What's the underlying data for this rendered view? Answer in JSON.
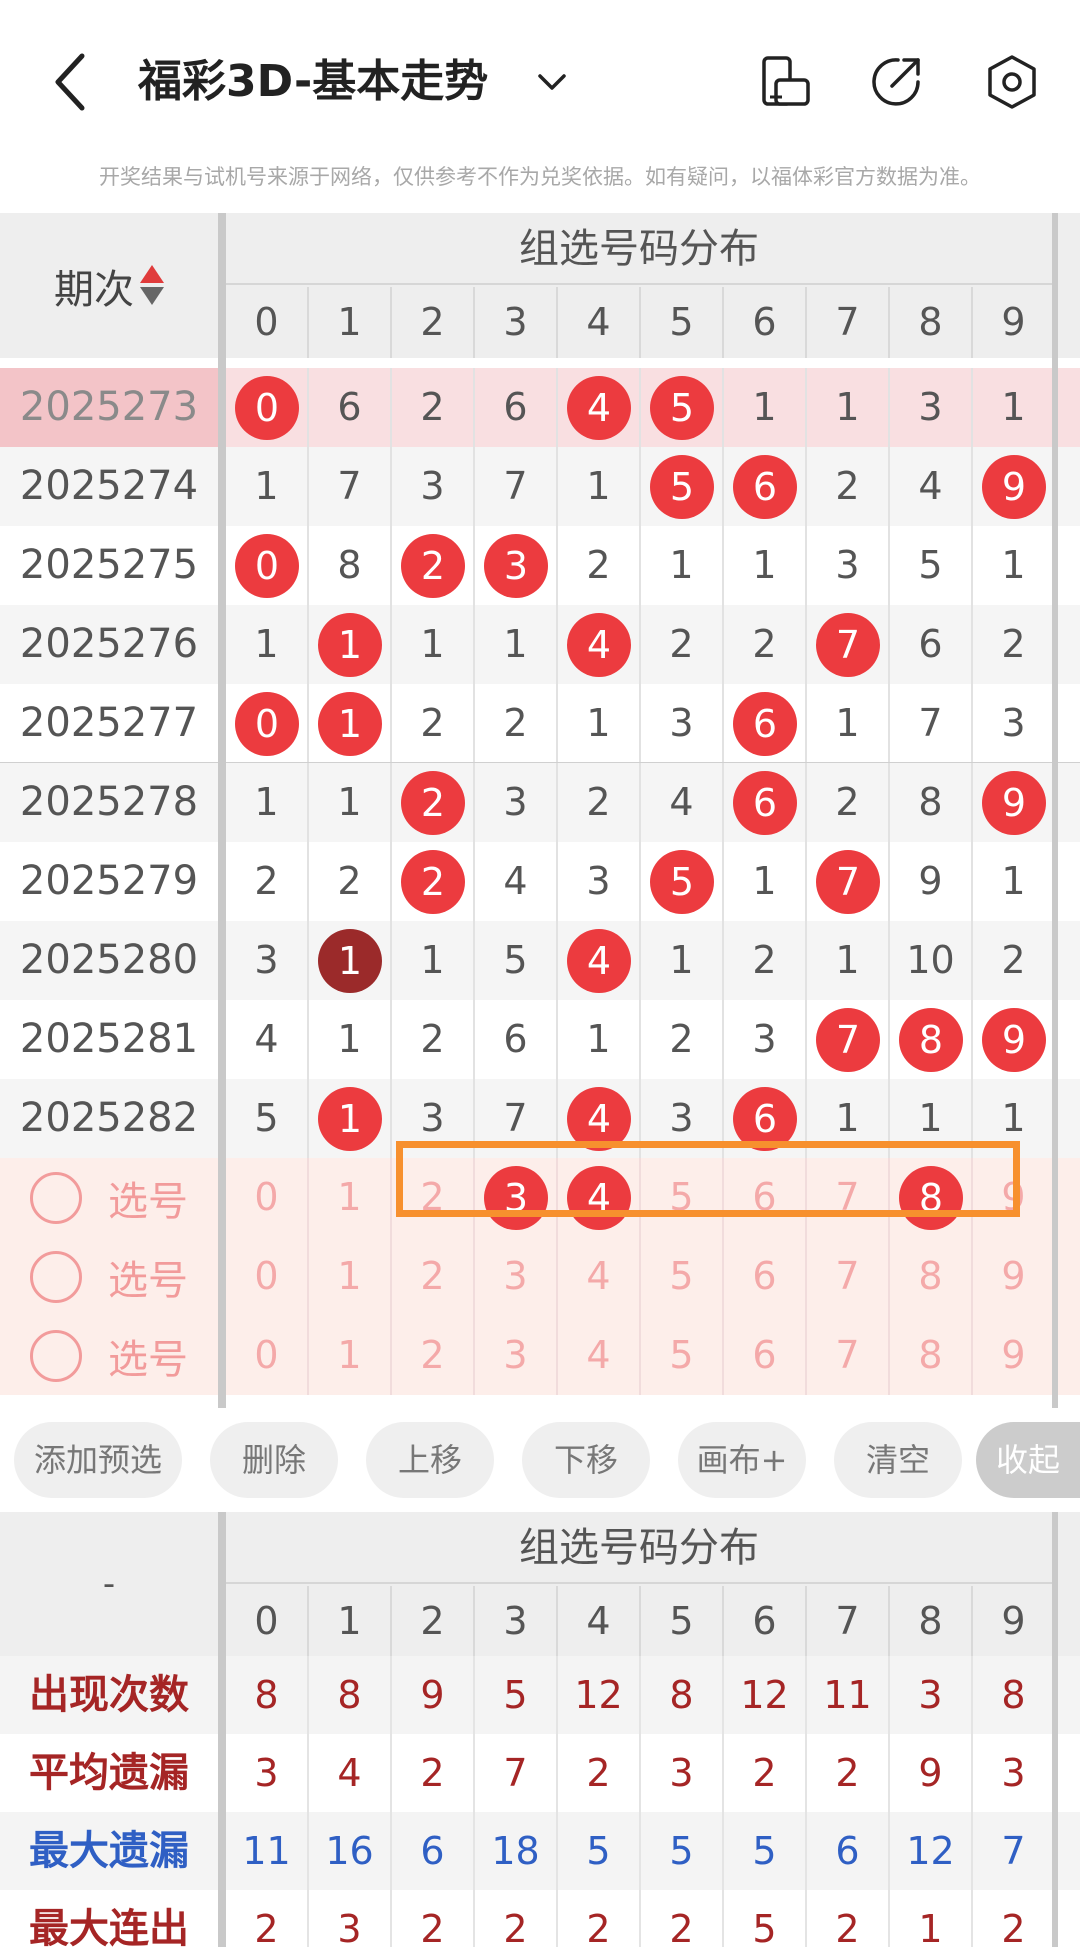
{
  "header": {
    "title": "福彩3D-基本走势",
    "disclaimer": "开奖结果与试机号来源于网络，仅供参考不作为兑奖依据。如有疑问，以福体彩官方数据为准。"
  },
  "table": {
    "period_label": "期次",
    "group_title": "组选号码分布",
    "digits": [
      "0",
      "1",
      "2",
      "3",
      "4",
      "5",
      "6",
      "7",
      "8",
      "9"
    ],
    "rows": [
      {
        "period": "2025273",
        "cells": [
          "0",
          "6",
          "2",
          "6",
          "4",
          "5",
          "1",
          "1",
          "3",
          "1"
        ],
        "balls": [
          0,
          4,
          5
        ],
        "highlight": true
      },
      {
        "period": "2025274",
        "cells": [
          "1",
          "7",
          "3",
          "7",
          "1",
          "5",
          "6",
          "2",
          "4",
          "9"
        ],
        "balls": [
          5,
          6,
          9
        ]
      },
      {
        "period": "2025275",
        "cells": [
          "0",
          "8",
          "2",
          "3",
          "2",
          "1",
          "1",
          "3",
          "5",
          "1"
        ],
        "balls": [
          0,
          2,
          3
        ]
      },
      {
        "period": "2025276",
        "cells": [
          "1",
          "1",
          "1",
          "1",
          "4",
          "2",
          "2",
          "7",
          "6",
          "2"
        ],
        "balls": [
          1,
          4,
          7
        ]
      },
      {
        "period": "2025277",
        "cells": [
          "0",
          "1",
          "2",
          "2",
          "1",
          "3",
          "6",
          "1",
          "7",
          "3"
        ],
        "balls": [
          0,
          1,
          6
        ]
      },
      {
        "period": "2025278",
        "cells": [
          "1",
          "1",
          "2",
          "3",
          "2",
          "4",
          "6",
          "2",
          "8",
          "9"
        ],
        "balls": [
          2,
          6,
          9
        ]
      },
      {
        "period": "2025279",
        "cells": [
          "2",
          "2",
          "2",
          "4",
          "3",
          "5",
          "1",
          "7",
          "9",
          "1"
        ],
        "balls": [
          2,
          5,
          7
        ]
      },
      {
        "period": "2025280",
        "cells": [
          "3",
          "1",
          "1",
          "5",
          "4",
          "1",
          "2",
          "1",
          "10",
          "2"
        ],
        "balls": [
          1,
          4
        ],
        "dark": [
          1
        ]
      },
      {
        "period": "2025281",
        "cells": [
          "4",
          "1",
          "2",
          "6",
          "1",
          "2",
          "3",
          "7",
          "8",
          "9"
        ],
        "balls": [
          7,
          8,
          9
        ]
      },
      {
        "period": "2025282",
        "cells": [
          "5",
          "1",
          "3",
          "7",
          "4",
          "3",
          "6",
          "1",
          "1",
          "1"
        ],
        "balls": [
          1,
          4,
          6
        ]
      }
    ],
    "pick_label": "选号",
    "pick_rows": [
      {
        "cells": [
          "0",
          "1",
          "2",
          "3",
          "4",
          "5",
          "6",
          "7",
          "8",
          "9"
        ],
        "selected": [
          3,
          4,
          8
        ]
      },
      {
        "cells": [
          "0",
          "1",
          "2",
          "3",
          "4",
          "5",
          "6",
          "7",
          "8",
          "9"
        ],
        "selected": []
      },
      {
        "cells": [
          "0",
          "1",
          "2",
          "3",
          "4",
          "5",
          "6",
          "7",
          "8",
          "9"
        ],
        "selected": []
      }
    ]
  },
  "toolbar": {
    "add_preselect": "添加预选",
    "delete": "删除",
    "move_up": "上移",
    "move_down": "下移",
    "canvas_plus": "画布+",
    "clear": "清空",
    "collapse": "收起"
  },
  "stats": {
    "corner": "-",
    "group_title": "组选号码分布",
    "rows": [
      {
        "label": "出现次数",
        "color": "#a52525",
        "values": [
          "8",
          "8",
          "9",
          "5",
          "12",
          "8",
          "12",
          "11",
          "3",
          "8"
        ]
      },
      {
        "label": "平均遗漏",
        "color": "#a52525",
        "values": [
          "3",
          "4",
          "2",
          "7",
          "2",
          "3",
          "2",
          "2",
          "9",
          "3"
        ]
      },
      {
        "label": "最大遗漏",
        "color": "#2f5fc4",
        "values": [
          "11",
          "16",
          "6",
          "18",
          "5",
          "5",
          "5",
          "6",
          "12",
          "7"
        ]
      },
      {
        "label": "最大连出",
        "color": "#a52525",
        "values": [
          "2",
          "3",
          "2",
          "2",
          "2",
          "2",
          "5",
          "2",
          "1",
          "2"
        ]
      }
    ]
  },
  "colors": {
    "ball_red": "#ec3b3f",
    "ball_dark": "#9b2a2a",
    "highlight_box": "#f7902e"
  }
}
